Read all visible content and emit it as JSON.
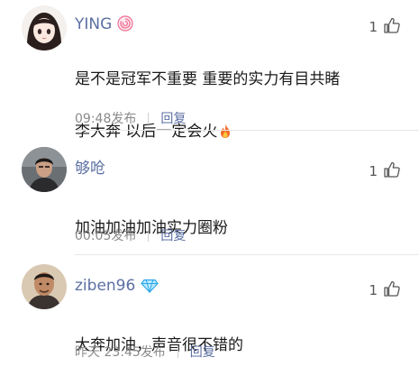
{
  "comments": [
    {
      "username": "YING",
      "badge_icon": "lollipop-icon",
      "likes": "1",
      "content_lines": [
        "是不是冠军不重要  重要的实力有目共睹",
        "李大奔 以后一定会火"
      ],
      "content_emoji": "fire-icon",
      "time": "09:48发布",
      "reply_label": "回复"
    },
    {
      "username": "够呛",
      "likes": "1",
      "content_lines": [
        "加油加油加油实力圈粉"
      ],
      "time": "00:05发布",
      "reply_label": "回复"
    },
    {
      "username": "ziben96",
      "badge_icon": "diamond-icon",
      "likes": "1",
      "content_lines": [
        "大奔加油，声音很不错的"
      ],
      "time": "昨天 23:45发布",
      "reply_label": "回复"
    }
  ],
  "colors": {
    "username": "#5b6fa3",
    "meta": "#8a8a8a",
    "text": "#1a1a1a",
    "divider": "#e8e8e8"
  }
}
